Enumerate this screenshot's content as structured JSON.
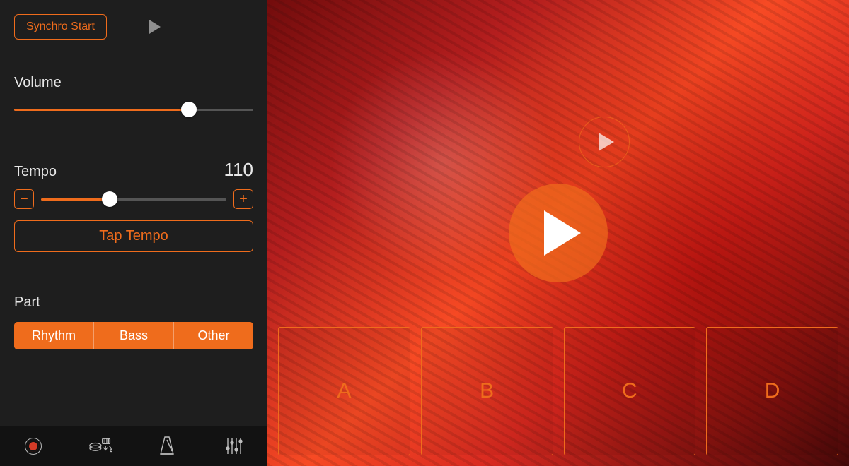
{
  "accent": "#ef6c1c",
  "sidebar": {
    "synchro_label": "Synchro Start",
    "volume": {
      "label": "Volume",
      "percent": 73
    },
    "tempo": {
      "label": "Tempo",
      "value": "110",
      "percent": 37,
      "tap_label": "Tap Tempo"
    },
    "part": {
      "label": "Part",
      "options": [
        "Rhythm",
        "Bass",
        "Other"
      ]
    }
  },
  "bottombar": {
    "icons": [
      "record-icon",
      "sample-export-icon",
      "metronome-icon",
      "mixer-icon"
    ]
  },
  "main": {
    "play_icon": "play-icon",
    "mini_play_icon": "play-icon",
    "pads": [
      "A",
      "B",
      "C",
      "D"
    ]
  }
}
